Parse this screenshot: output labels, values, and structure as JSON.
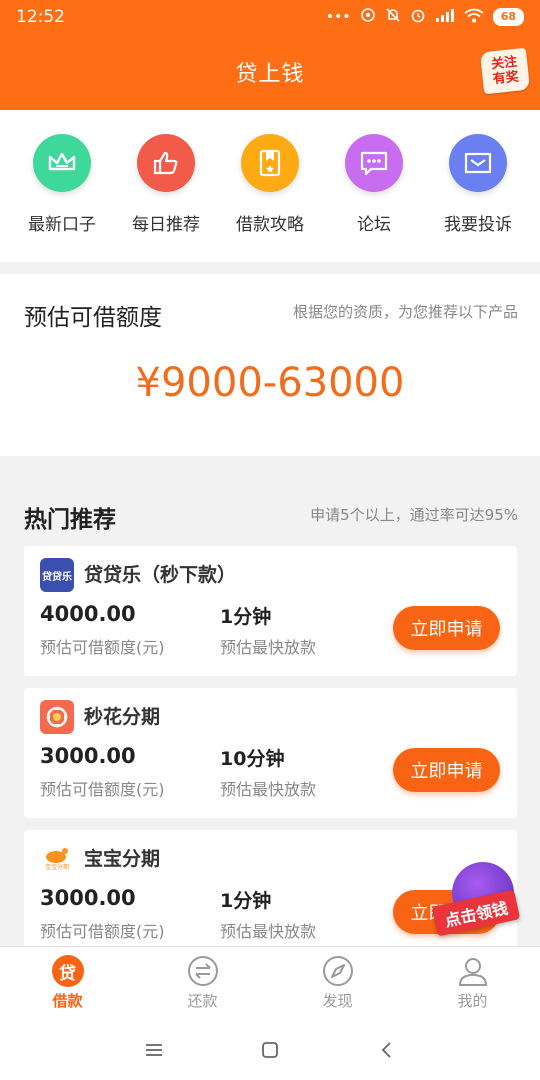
{
  "status_bar": {
    "time": "12:52",
    "battery": "68"
  },
  "header": {
    "title": "贷上钱",
    "badge_line1": "关注",
    "badge_line2": "有奖"
  },
  "quick_actions": [
    {
      "label": "最新口子",
      "icon": "crown-icon",
      "color": "#3ed99a"
    },
    {
      "label": "每日推荐",
      "icon": "thumbs-up-icon",
      "color": "#f25b4a"
    },
    {
      "label": "借款攻略",
      "icon": "bookmark-icon",
      "color": "#fdaa14"
    },
    {
      "label": "论坛",
      "icon": "chat-bubble-icon",
      "color": "#c86cf0"
    },
    {
      "label": "我要投诉",
      "icon": "mail-icon",
      "color": "#6a7ff0"
    }
  ],
  "estimate": {
    "title": "预估可借额度",
    "note": "根据您的资质，为您推荐以下产品",
    "amount": "¥9000-63000"
  },
  "hot": {
    "title": "热门推荐",
    "note": "申请5个以上，通过率可达95%",
    "products": [
      {
        "name": "贷贷乐（秒下款）",
        "logo_text": "贷贷乐",
        "amount": "4000.00",
        "amount_label": "预估可借额度(元)",
        "time": "1分钟",
        "time_label": "预估最快放款",
        "button": "立即申请"
      },
      {
        "name": "秒花分期",
        "logo_text": "",
        "amount": "3000.00",
        "amount_label": "预估可借额度(元)",
        "time": "10分钟",
        "time_label": "预估最快放款",
        "button": "立即申请"
      },
      {
        "name": "宝宝分期",
        "logo_text": "宝宝分期",
        "amount": "3000.00",
        "amount_label": "预估可借额度(元)",
        "time": "1分钟",
        "time_label": "预估最快放款",
        "button": "立即申请"
      }
    ]
  },
  "promo": {
    "label": "点击领钱"
  },
  "bottom_nav": [
    {
      "label": "借款",
      "icon": "loan-icon",
      "active": true,
      "glyph": "贷"
    },
    {
      "label": "还款",
      "icon": "repay-icon",
      "active": false
    },
    {
      "label": "发现",
      "icon": "compass-icon",
      "active": false
    },
    {
      "label": "我的",
      "icon": "user-icon",
      "active": false
    }
  ],
  "colors": {
    "brand": "#fe6e14",
    "accent": "#f86414",
    "amount": "#f26d1b"
  }
}
